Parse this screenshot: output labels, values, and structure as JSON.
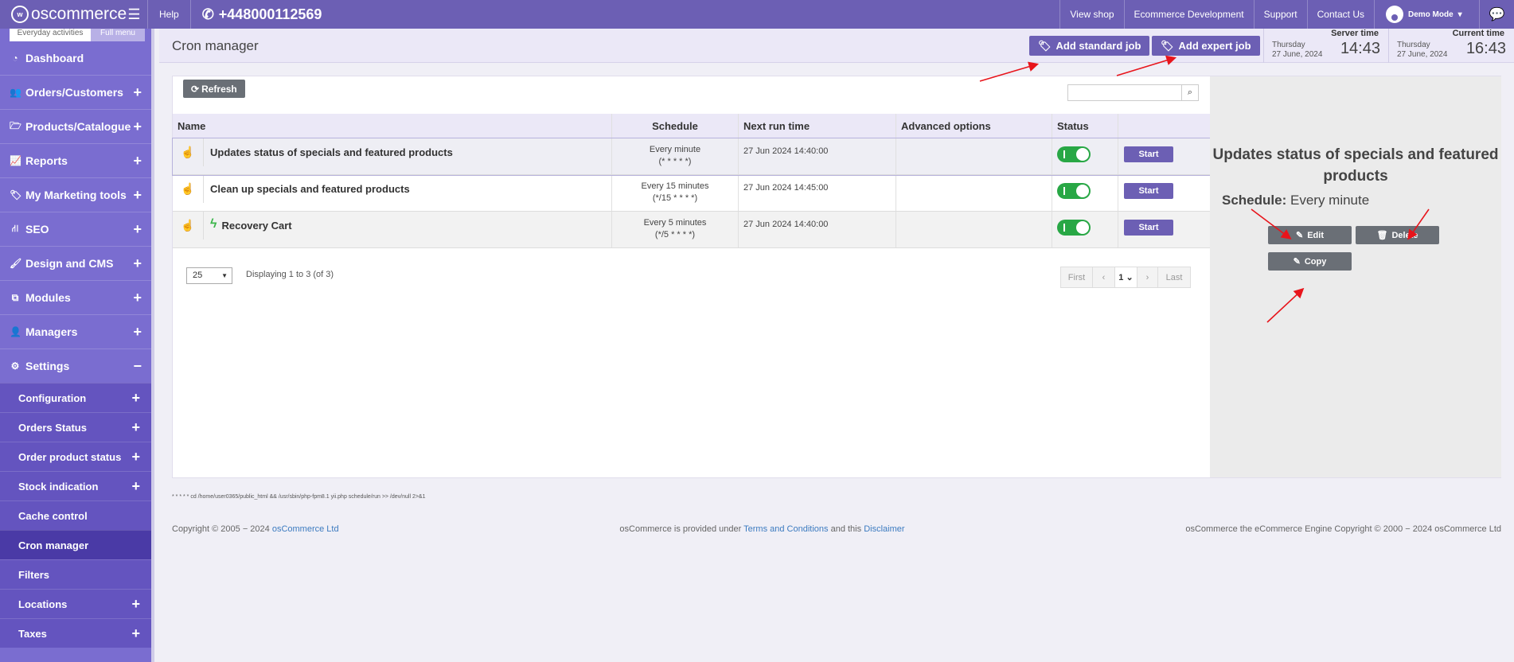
{
  "topbar": {
    "logo": "oscommerce",
    "help": "Help",
    "phone": "+448000112569",
    "links": [
      "View shop",
      "Ecommerce Development",
      "Support",
      "Contact Us"
    ],
    "user": "Demo Mode"
  },
  "sidebar": {
    "tab_everyday": "Everyday activities",
    "tab_full": "Full menu",
    "items": [
      {
        "label": "Dashboard",
        "icon": "dashboard-icon",
        "expand": ""
      },
      {
        "label": "Orders/Customers",
        "icon": "users-icon",
        "expand": "+"
      },
      {
        "label": "Products/Catalogue",
        "icon": "folder-icon",
        "expand": "+"
      },
      {
        "label": "Reports",
        "icon": "chart-icon",
        "expand": "+"
      },
      {
        "label": "My Marketing tools",
        "icon": "tag-icon",
        "expand": "+"
      },
      {
        "label": "SEO",
        "icon": "sitemap-icon",
        "expand": "+"
      },
      {
        "label": "Design and CMS",
        "icon": "brush-icon",
        "expand": "+"
      },
      {
        "label": "Modules",
        "icon": "puzzle-icon",
        "expand": "+"
      },
      {
        "label": "Managers",
        "icon": "user-icon",
        "expand": "+"
      },
      {
        "label": "Settings",
        "icon": "cogs-icon",
        "expand": "−"
      }
    ],
    "subitems": [
      {
        "label": "Configuration",
        "expand": "+"
      },
      {
        "label": "Orders Status",
        "expand": "+"
      },
      {
        "label": "Order product status",
        "expand": "+"
      },
      {
        "label": "Stock indication",
        "expand": "+"
      },
      {
        "label": "Cache control",
        "expand": ""
      },
      {
        "label": "Cron manager",
        "expand": ""
      },
      {
        "label": "Filters",
        "expand": ""
      },
      {
        "label": "Locations",
        "expand": "+"
      },
      {
        "label": "Taxes",
        "expand": "+"
      }
    ]
  },
  "header": {
    "title": "Cron manager",
    "add_standard": "Add standard job",
    "add_expert": "Add expert job",
    "server_time_label": "Server time",
    "server_day": "Thursday",
    "server_date": "27 June, 2024",
    "server_time": "14:43",
    "current_time_label": "Current time",
    "current_day": "Thursday",
    "current_date": "27 June, 2024",
    "current_time": "16:43"
  },
  "toolbar": {
    "refresh": "Refresh",
    "search_placeholder": ""
  },
  "table": {
    "columns": [
      "Name",
      "Schedule",
      "Next run time",
      "Advanced options",
      "Status",
      ""
    ],
    "rows": [
      {
        "name": "Updates status of specials and featured products",
        "schedule": "Every minute",
        "cron": "(* * * * *)",
        "next": "27 Jun 2024 14:40:00",
        "status": "on",
        "action": "Start",
        "bolt": ""
      },
      {
        "name": "Clean up specials and featured products",
        "schedule": "Every 15 minutes",
        "cron": "(*/15 * * * *)",
        "next": "27 Jun 2024 14:45:00",
        "status": "on",
        "action": "Start",
        "bolt": ""
      },
      {
        "name": "Recovery Cart",
        "schedule": "Every 5 minutes",
        "cron": "(*/5 * * * *)",
        "next": "27 Jun 2024 14:40:00",
        "status": "on",
        "action": "Start",
        "bolt": "ϟ"
      }
    ]
  },
  "pagination": {
    "per_page": "25",
    "displaying": "Displaying 1 to 3 (of 3)",
    "first": "First",
    "page": "1",
    "last": "Last"
  },
  "details": {
    "title": "Updates status of specials and featured products",
    "schedule_label": "Schedule:",
    "schedule_value": "Every minute",
    "edit": "Edit",
    "delete": "Delete",
    "copy": "Copy"
  },
  "cmd_line": "* * * * * cd /home/user0365/public_html && /usr/sbin/php-fpm8.1 yii.php schedule/run >> /dev/null 2>&1",
  "footer": {
    "copyright_prefix": "Copyright © 2005 − 2024",
    "copyright_link": "osCommerce Ltd",
    "provided_prefix": "osCommerce is provided under",
    "terms": "Terms and Conditions",
    "and_this": "and this",
    "disclaimer": "Disclaimer",
    "engine": "osCommerce the eCommerce Engine Copyright © 2000 − 2024 osCommerce Ltd"
  },
  "colors": {
    "brand": "#6c5fb4",
    "sidebar": "#7a6dd0",
    "toggle_on": "#28a745",
    "annotation_arrow": "#e8141b"
  }
}
